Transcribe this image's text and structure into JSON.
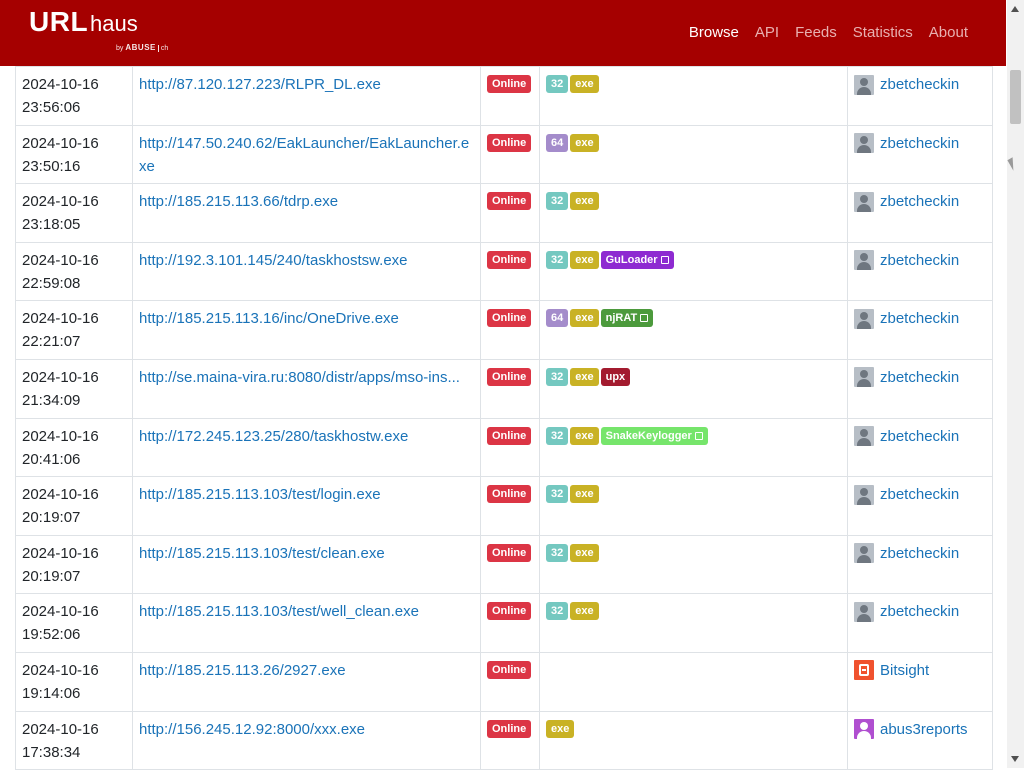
{
  "brand": {
    "url": "URL",
    "haus": "haus",
    "by": "by",
    "abuse": "ABUSE",
    "ch": "ch"
  },
  "nav": [
    {
      "label": "Browse",
      "active": true
    },
    {
      "label": "API",
      "active": false
    },
    {
      "label": "Feeds",
      "active": false
    },
    {
      "label": "Statistics",
      "active": false
    },
    {
      "label": "About",
      "active": false
    }
  ],
  "rows": [
    {
      "date": "2024-10-16",
      "time": "23:56:06",
      "url": "http://87.120.127.223/RLPR_DL.exe",
      "status": "Online",
      "tags": [
        "32",
        "exe"
      ],
      "family": null,
      "reporter": "zbetcheckin",
      "avatar": "default"
    },
    {
      "date": "2024-10-16",
      "time": "23:50:16",
      "url": "http://147.50.240.62/EakLauncher/EakLauncher.exe",
      "status": "Online",
      "tags": [
        "64",
        "exe"
      ],
      "family": null,
      "reporter": "zbetcheckin",
      "avatar": "default"
    },
    {
      "date": "2024-10-16",
      "time": "23:18:05",
      "url": "http://185.215.113.66/tdrp.exe",
      "status": "Online",
      "tags": [
        "32",
        "exe"
      ],
      "family": null,
      "reporter": "zbetcheckin",
      "avatar": "default"
    },
    {
      "date": "2024-10-16",
      "time": "22:59:08",
      "url": "http://192.3.101.145/240/taskhostsw.exe",
      "status": "Online",
      "tags": [
        "32",
        "exe"
      ],
      "family": {
        "label": "GuLoader",
        "color": "#8e2ad1"
      },
      "reporter": "zbetcheckin",
      "avatar": "default"
    },
    {
      "date": "2024-10-16",
      "time": "22:21:07",
      "url": "http://185.215.113.16/inc/OneDrive.exe",
      "status": "Online",
      "tags": [
        "64",
        "exe"
      ],
      "family": {
        "label": "njRAT",
        "color": "#4c9a3c"
      },
      "reporter": "zbetcheckin",
      "avatar": "default"
    },
    {
      "date": "2024-10-16",
      "time": "21:34:09",
      "url": "http://se.maina-vira.ru:8080/distr/apps/mso-ins...",
      "status": "Online",
      "tags": [
        "32",
        "exe",
        "upx"
      ],
      "family": null,
      "reporter": "zbetcheckin",
      "avatar": "default"
    },
    {
      "date": "2024-10-16",
      "time": "20:41:06",
      "url": "http://172.245.123.25/280/taskhostw.exe",
      "status": "Online",
      "tags": [
        "32",
        "exe"
      ],
      "family": {
        "label": "SnakeKeylogger",
        "color": "#76e56b"
      },
      "reporter": "zbetcheckin",
      "avatar": "default"
    },
    {
      "date": "2024-10-16",
      "time": "20:19:07",
      "url": "http://185.215.113.103/test/login.exe",
      "status": "Online",
      "tags": [
        "32",
        "exe"
      ],
      "family": null,
      "reporter": "zbetcheckin",
      "avatar": "default"
    },
    {
      "date": "2024-10-16",
      "time": "20:19:07",
      "url": "http://185.215.113.103/test/clean.exe",
      "status": "Online",
      "tags": [
        "32",
        "exe"
      ],
      "family": null,
      "reporter": "zbetcheckin",
      "avatar": "default"
    },
    {
      "date": "2024-10-16",
      "time": "19:52:06",
      "url": "http://185.215.113.103/test/well_clean.exe",
      "status": "Online",
      "tags": [
        "32",
        "exe"
      ],
      "family": null,
      "reporter": "zbetcheckin",
      "avatar": "default"
    },
    {
      "date": "2024-10-16",
      "time": "19:14:06",
      "url": "http://185.215.113.26/2927.exe",
      "status": "Online",
      "tags": [],
      "family": null,
      "reporter": "Bitsight",
      "avatar": "bitsight"
    },
    {
      "date": "2024-10-16",
      "time": "17:38:34",
      "url": "http://156.245.12.92:8000/xxx.exe",
      "status": "Online",
      "tags": [
        "exe"
      ],
      "family": null,
      "reporter": "abus3reports",
      "avatar": "purple"
    }
  ],
  "colors": {
    "header_bg": "#a50000",
    "link": "#1a73b8",
    "online": "#dc3545",
    "tag_32": "#74c8c0",
    "tag_64": "#a48ccb",
    "tag_exe": "#c9b225",
    "tag_upx": "#a31b2f"
  }
}
